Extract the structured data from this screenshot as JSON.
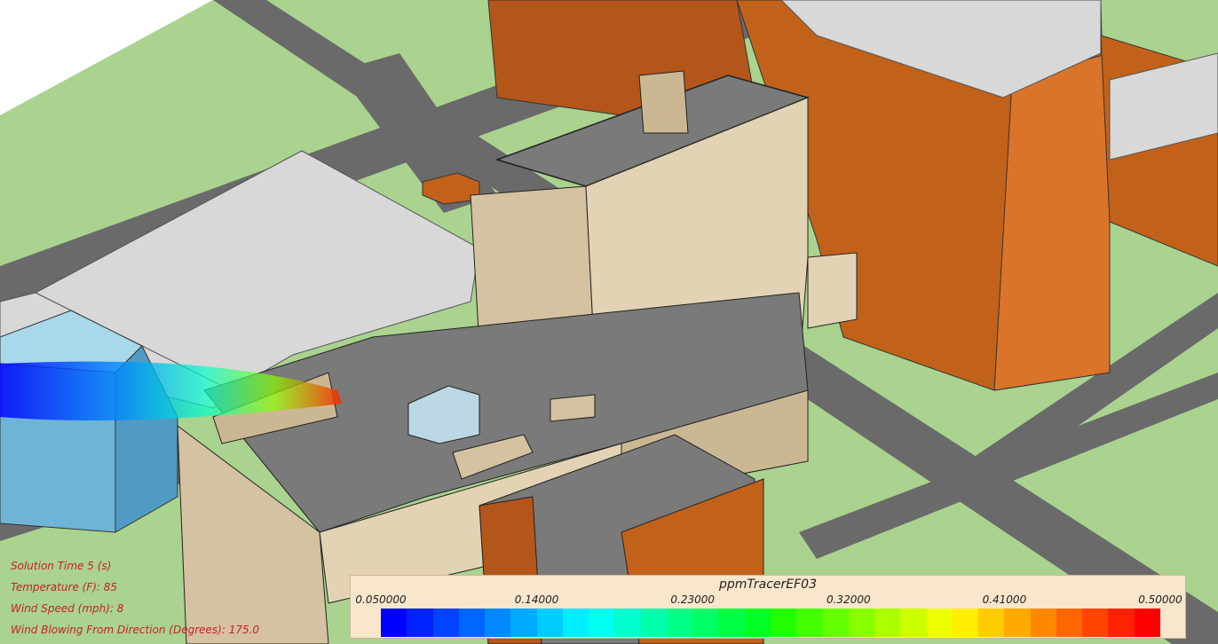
{
  "simulation_info": {
    "solution_time": "Solution Time 5 (s)",
    "temperature": "Temperature (F): 85",
    "wind_speed": "Wind Speed (mph): 8",
    "wind_direction": "Wind Blowing From Direction (Degrees): 175.0"
  },
  "legend": {
    "title": "ppmTracerEF03",
    "ticks": [
      "0.050000",
      "0.14000",
      "0.23000",
      "0.32000",
      "0.41000",
      "0.50000"
    ],
    "colors": [
      "#0000ff",
      "#0022ff",
      "#0044ff",
      "#0066ff",
      "#0088ff",
      "#00aaff",
      "#00ccff",
      "#00eeff",
      "#00ffee",
      "#00ffcc",
      "#00ffaa",
      "#00ff88",
      "#00ff66",
      "#00ff44",
      "#00ff22",
      "#22ff00",
      "#44ff00",
      "#66ff00",
      "#88ff00",
      "#aaff00",
      "#ccff00",
      "#eeff00",
      "#ffee00",
      "#ffcc00",
      "#ffaa00",
      "#ff8800",
      "#ff6600",
      "#ff4400",
      "#ff2200",
      "#ff0000"
    ]
  },
  "colors": {
    "ground": "#a9d38e",
    "road": "#6a6a6a",
    "tan_building": "#d4c2a0",
    "orange_building": "#c2621a",
    "roof": "#7a7a7a",
    "info_text": "#c8202a"
  }
}
